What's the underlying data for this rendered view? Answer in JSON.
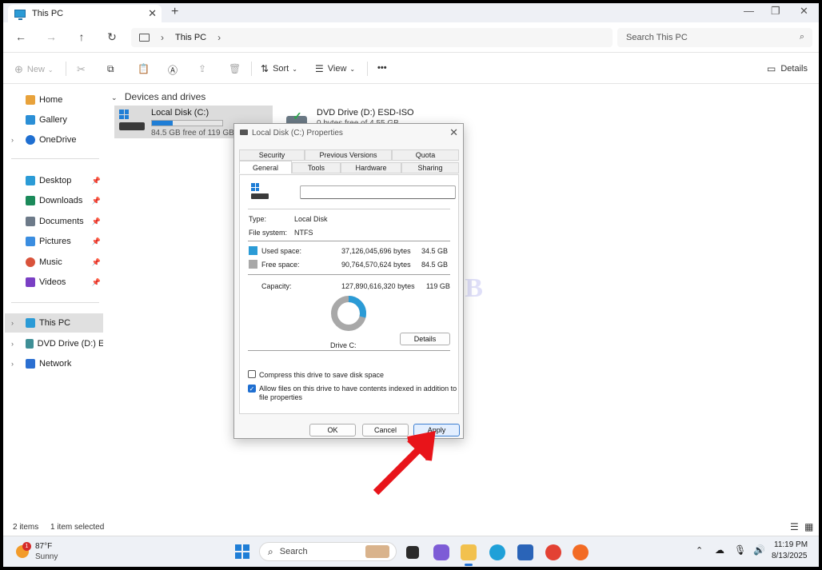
{
  "window": {
    "tab_title": "This PC",
    "new_tab": "+",
    "close_tab": "✕",
    "controls": {
      "minimize": "—",
      "maximize": "❐",
      "close": "✕"
    }
  },
  "navigation": {
    "back": "←",
    "forward": "→",
    "up": "↑",
    "refresh": "↻",
    "breadcrumb": "This PC",
    "search_placeholder": "Search This PC"
  },
  "commandbar": {
    "new_label": "New",
    "sort_label": "Sort",
    "view_label": "View",
    "more_label": "•••",
    "details_label": "Details"
  },
  "sidebar": {
    "items": [
      {
        "label": "Home",
        "color": "#e8a23b"
      },
      {
        "label": "Gallery",
        "color": "#2b8fd6"
      },
      {
        "label": "OneDrive",
        "color": "#1f6fd1"
      },
      {
        "label": "Desktop",
        "color": "#2b9bd6"
      },
      {
        "label": "Downloads",
        "color": "#1b8a5a"
      },
      {
        "label": "Documents",
        "color": "#6d7a89"
      },
      {
        "label": "Pictures",
        "color": "#3a8de0"
      },
      {
        "label": "Music",
        "color": "#d9533b"
      },
      {
        "label": "Videos",
        "color": "#7a3fc4"
      },
      {
        "label": "This PC",
        "color": "#2b9bd6"
      },
      {
        "label": "DVD Drive (D:) ESD-",
        "color": "#3f8f96"
      },
      {
        "label": "Network",
        "color": "#2b6fd1"
      }
    ]
  },
  "content": {
    "group_header": "Devices and drives",
    "drives": [
      {
        "name": "Local Disk (C:)",
        "free_text": "84.5 GB free of 119 GB",
        "used_fraction": 0.29
      },
      {
        "name": "DVD Drive (D:) ESD-ISO",
        "free_text": "0 bytes free of 4.55 GB"
      }
    ]
  },
  "statusbar": {
    "items": "2 items",
    "selected": "1 item selected"
  },
  "dialog": {
    "title": "Local Disk (C:) Properties",
    "tabs_row1": [
      "Security",
      "Previous Versions",
      "Quota"
    ],
    "tabs_row2": [
      "General",
      "Tools",
      "Hardware",
      "Sharing"
    ],
    "active_tab": "General",
    "name_value": "",
    "type_label": "Type:",
    "type_value": "Local Disk",
    "fs_label": "File system:",
    "fs_value": "NTFS",
    "used_label": "Used space:",
    "used_bytes": "37,126,045,696 bytes",
    "used_gb": "34.5 GB",
    "free_label": "Free space:",
    "free_bytes": "90,764,570,624 bytes",
    "free_gb": "84.5 GB",
    "capacity_label": "Capacity:",
    "capacity_bytes": "127,890,616,320 bytes",
    "capacity_gb": "119 GB",
    "drive_label": "Drive C:",
    "details_button": "Details",
    "compress_label": "Compress this drive to save disk space",
    "compress_checked": false,
    "index_label_1": "Allow files on this drive to have contents indexed in addition to",
    "index_label_2": "file properties",
    "index_checked": true,
    "used_color": "#2b9bd6",
    "free_color": "#a8a8a8",
    "used_fraction": 0.29,
    "ok_button": "OK",
    "cancel_button": "Cancel",
    "apply_button": "Apply"
  },
  "watermark": "ITTECHHUB",
  "taskbar": {
    "weather_temp": "87°F",
    "weather_cond": "Sunny",
    "weather_badge": "1",
    "search_label": "Search",
    "time": "11:19 PM",
    "date": "8/13/2025"
  }
}
